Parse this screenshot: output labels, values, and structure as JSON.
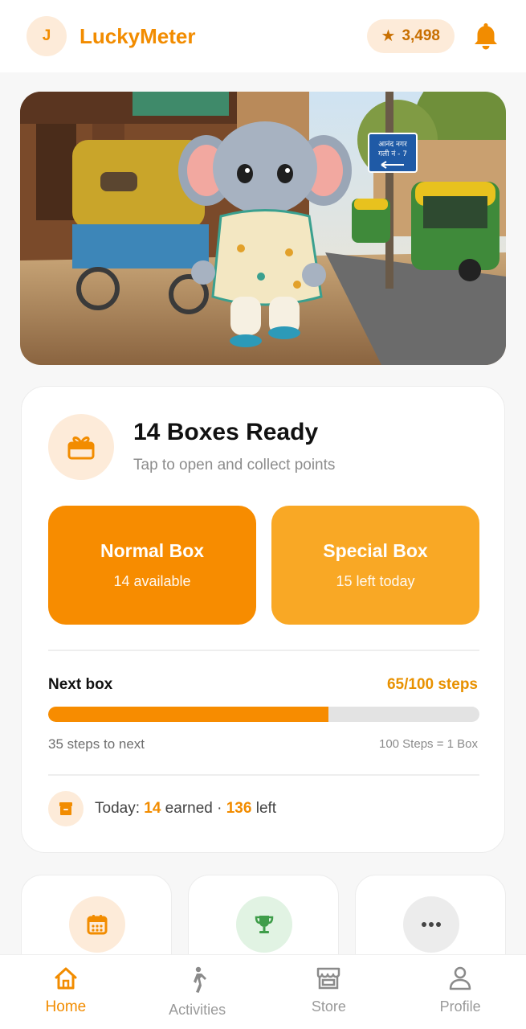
{
  "header": {
    "avatar_initial": "J",
    "app_title": "LuckyMeter",
    "points": "3,498",
    "icons": [
      "star-icon",
      "bell-icon"
    ]
  },
  "hero": {
    "sign_text_line1": "आनंद नगर",
    "sign_text_line2": "गली नं - 7"
  },
  "boxes_card": {
    "title": "14 Boxes Ready",
    "subtitle": "Tap to open and collect points",
    "normal_box": {
      "title": "Normal Box",
      "subtitle": "14 available"
    },
    "special_box": {
      "title": "Special Box",
      "subtitle": "15 left today"
    },
    "next_box_label": "Next box",
    "next_box_steps": "65/100 steps",
    "progress_fraction": 0.65,
    "steps_to_next": "35 steps to next",
    "steps_rule": "100 Steps = 1 Box",
    "today": {
      "prefix": "Today: ",
      "earned": "14",
      "earned_suffix": " earned · ",
      "left": "136",
      "left_suffix": " left"
    }
  },
  "tiles": [
    {
      "icon": "calendar-icon"
    },
    {
      "icon": "trophy-icon"
    },
    {
      "icon": "more-icon"
    }
  ],
  "bottom_nav": [
    {
      "label": "Home",
      "icon": "home-icon",
      "active": true
    },
    {
      "label": "Activities",
      "icon": "walking-icon",
      "active": false
    },
    {
      "label": "Store",
      "icon": "store-icon",
      "active": false
    },
    {
      "label": "Profile",
      "icon": "person-icon",
      "active": false
    }
  ],
  "colors": {
    "accent": "#f28c00",
    "normal_box": "#f78c00",
    "special_box": "#f9a825",
    "accent_soft": "#fdebd9"
  }
}
